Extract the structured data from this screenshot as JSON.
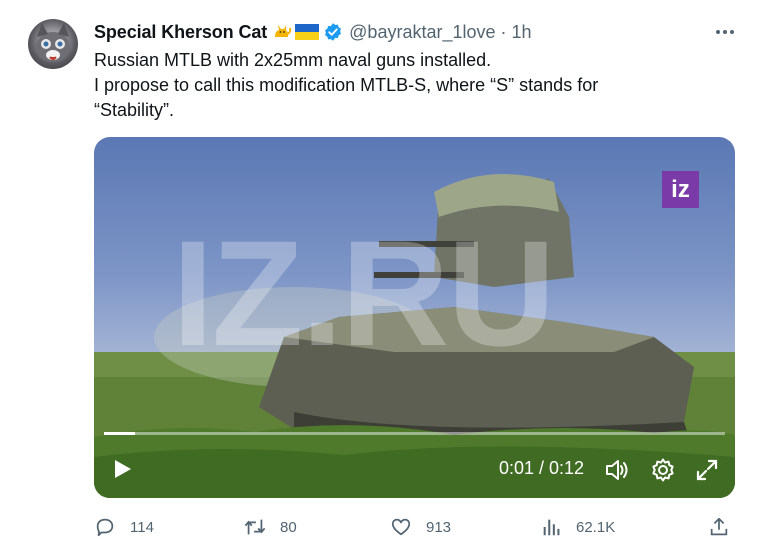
{
  "user": {
    "display_name": "Special Kherson Cat",
    "handle": "@bayraktar_1love",
    "separator": "·",
    "time": "1h"
  },
  "icons": {
    "emoji_1": "cat-emoji",
    "emoji_2": "ukraine-flag-emoji",
    "verified": "verified-badge-icon"
  },
  "tweet": {
    "lines": [
      "Russian MTLB with 2x25mm naval guns installed.",
      "I propose to call this modification MTLB-S, where “S” stands for",
      "“Stability”."
    ]
  },
  "video": {
    "watermark": "IZ.RU",
    "logo": "iz",
    "timecode": "0:01 / 0:12",
    "progress": 0.05
  },
  "actions": {
    "replies": "114",
    "retweets": "80",
    "likes": "913",
    "views": "62.1K"
  },
  "colors": {
    "accent": "#1d9bf0",
    "muted": "#536471",
    "iz_purple": "#7a3ba8"
  }
}
